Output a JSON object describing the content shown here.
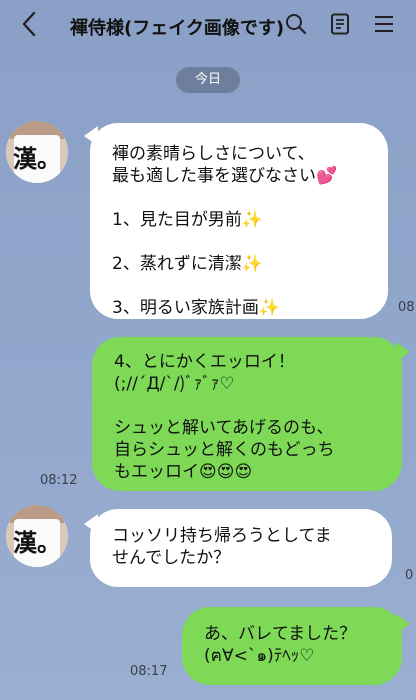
{
  "header": {
    "title": "褌侍様(フェイク画像です)"
  },
  "date_pill": "今日",
  "messages": [
    {
      "side": "left",
      "text": "褌の素晴らしさについて、\n最も適した事を選びなさい💕\n\n1、見た目が男前✨\n\n2、蒸れずに清潔✨\n\n3、明るい家族計画✨",
      "time": "08"
    },
    {
      "side": "right",
      "text": "4、とにかくエッロイ！\n(;//´Д/`/)ﾞｧﾞｧ♡\n\nシュッと解いてあげるのも、\n自らシュッと解くのもどっち\nもエッロイ😍😍😍",
      "time": "08:12"
    },
    {
      "side": "left",
      "text": "コッソリ持ち帰ろうとしてま\nせんでしたか？",
      "time": "0"
    },
    {
      "side": "right",
      "text": "あ、バレてました？\n(ฅ∀<`๑)ﾃﾍｯ♡",
      "time": "08:17"
    }
  ],
  "avatar_text": "漢。",
  "colors": {
    "background": "#8aa0c6",
    "left_bubble": "#ffffff",
    "right_bubble": "#7ed957",
    "date_pill": "#6e7f9e"
  },
  "icons": [
    "back-arrow-icon",
    "search-icon",
    "notes-icon",
    "menu-icon"
  ]
}
